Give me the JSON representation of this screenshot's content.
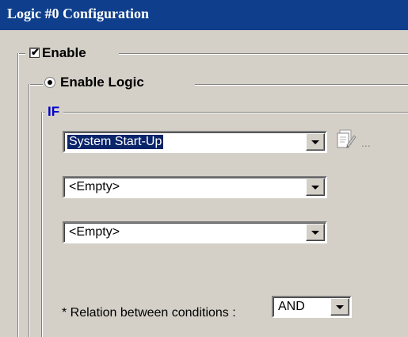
{
  "window": {
    "title": "Logic #0 Configuration"
  },
  "enable": {
    "label": "Enable",
    "checked": true,
    "check_glyph": "✔"
  },
  "enable_logic": {
    "label": "Enable Logic",
    "selected": true
  },
  "if_group": {
    "label": "IF"
  },
  "conditions": [
    {
      "value": "System Start-Up",
      "selected": true
    },
    {
      "value": "<Empty>",
      "selected": false
    },
    {
      "value": "<Empty>",
      "selected": false
    }
  ],
  "config_button": {
    "icon": "config-edit-icon",
    "ellipsis": "..."
  },
  "relation": {
    "label": "* Relation between conditions :",
    "value": "AND"
  },
  "colors": {
    "title_bar": "#0f3f8c",
    "panel": "#d4d0c8",
    "selection": "#0a246a",
    "if_label": "#0000cc"
  }
}
